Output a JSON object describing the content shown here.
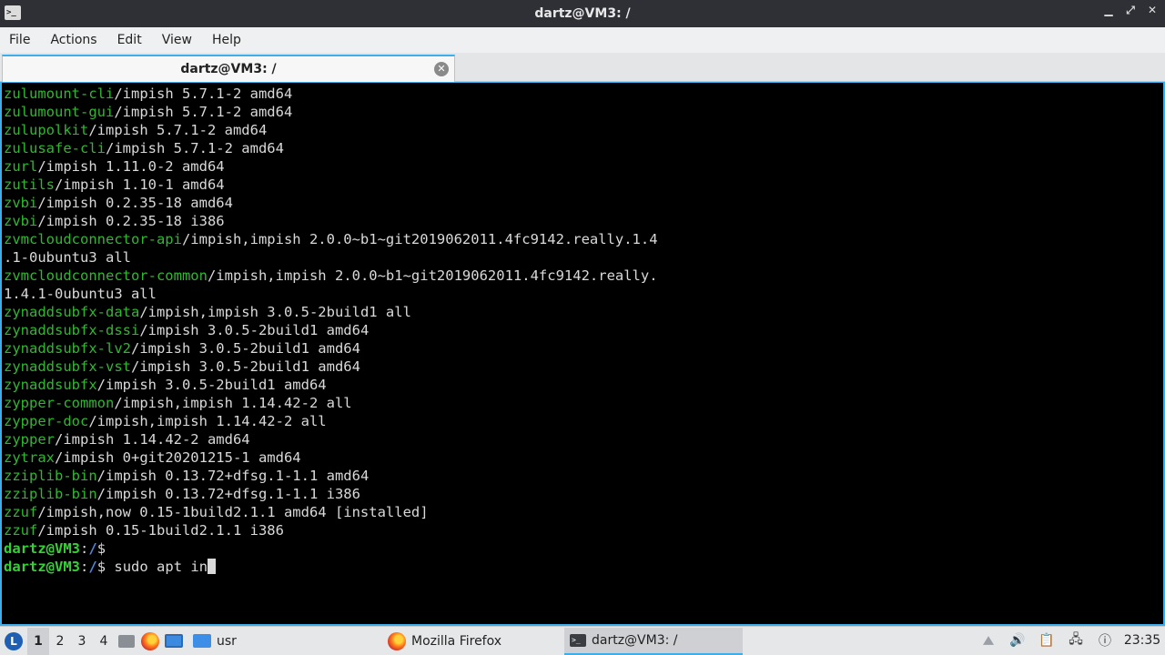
{
  "window": {
    "title": "dartz@VM3: /",
    "app_icon_glyph": ">_",
    "controls": {
      "minimize": "▁",
      "maximize": "⤢",
      "close": "✕"
    }
  },
  "menu": {
    "items": [
      "File",
      "Actions",
      "Edit",
      "View",
      "Help"
    ]
  },
  "tab": {
    "label": "dartz@VM3: /",
    "close_glyph": "✕"
  },
  "terminal": {
    "lines": [
      {
        "pkg": "zulumount-cli",
        "rest": "/impish 5.7.1-2 amd64"
      },
      {
        "pkg": "zulumount-gui",
        "rest": "/impish 5.7.1-2 amd64"
      },
      {
        "pkg": "zulupolkit",
        "rest": "/impish 5.7.1-2 amd64"
      },
      {
        "pkg": "zulusafe-cli",
        "rest": "/impish 5.7.1-2 amd64"
      },
      {
        "pkg": "zurl",
        "rest": "/impish 1.11.0-2 amd64"
      },
      {
        "pkg": "zutils",
        "rest": "/impish 1.10-1 amd64"
      },
      {
        "pkg": "zvbi",
        "rest": "/impish 0.2.35-18 amd64"
      },
      {
        "pkg": "zvbi",
        "rest": "/impish 0.2.35-18 i386"
      },
      {
        "pkg": "zvmcloudconnector-api",
        "rest": "/impish,impish 2.0.0~b1~git2019062011.4fc9142.really.1.4"
      },
      {
        "pkg": "",
        "rest": ".1-0ubuntu3 all"
      },
      {
        "pkg": "zvmcloudconnector-common",
        "rest": "/impish,impish 2.0.0~b1~git2019062011.4fc9142.really."
      },
      {
        "pkg": "",
        "rest": "1.4.1-0ubuntu3 all"
      },
      {
        "pkg": "zynaddsubfx-data",
        "rest": "/impish,impish 3.0.5-2build1 all"
      },
      {
        "pkg": "zynaddsubfx-dssi",
        "rest": "/impish 3.0.5-2build1 amd64"
      },
      {
        "pkg": "zynaddsubfx-lv2",
        "rest": "/impish 3.0.5-2build1 amd64"
      },
      {
        "pkg": "zynaddsubfx-vst",
        "rest": "/impish 3.0.5-2build1 amd64"
      },
      {
        "pkg": "zynaddsubfx",
        "rest": "/impish 3.0.5-2build1 amd64"
      },
      {
        "pkg": "zypper-common",
        "rest": "/impish,impish 1.14.42-2 all"
      },
      {
        "pkg": "zypper-doc",
        "rest": "/impish,impish 1.14.42-2 all"
      },
      {
        "pkg": "zypper",
        "rest": "/impish 1.14.42-2 amd64"
      },
      {
        "pkg": "zytrax",
        "rest": "/impish 0+git20201215-1 amd64"
      },
      {
        "pkg": "zziplib-bin",
        "rest": "/impish 0.13.72+dfsg.1-1.1 amd64"
      },
      {
        "pkg": "zziplib-bin",
        "rest": "/impish 0.13.72+dfsg.1-1.1 i386"
      },
      {
        "pkg": "zzuf",
        "rest": "/impish,now 0.15-1build2.1.1 amd64 [installed]"
      },
      {
        "pkg": "zzuf",
        "rest": "/impish 0.15-1build2.1.1 i386"
      }
    ],
    "prompt_user": "dartz@VM3",
    "prompt_sep": ":",
    "prompt_path": "/",
    "prompt_symbol": "$",
    "previous_command": "",
    "current_command": "sudo apt in"
  },
  "taskbar": {
    "start_logo": "L",
    "workspaces": [
      "1",
      "2",
      "3",
      "4"
    ],
    "active_workspace": "1",
    "quicklaunch": [
      "file-manager-icon",
      "firefox-icon",
      "show-desktop-icon"
    ],
    "tasks": [
      {
        "label": "usr",
        "icon": "folder-icon"
      },
      {
        "label": "Mozilla Firefox",
        "icon": "firefox-icon"
      },
      {
        "label": "dartz@VM3: /",
        "icon": "terminal-icon"
      }
    ],
    "tray": {
      "volume_glyph": "🔊",
      "clipboard_glyph": "📋",
      "network_glyph": "🖧",
      "update_glyph": "ⓘ",
      "clock": "23:35"
    }
  },
  "colors": {
    "accent": "#3daee9",
    "package_name": "#2fb82f",
    "prompt_user": "#34d134",
    "prompt_path": "#4b8be6",
    "terminal_bg": "#000000"
  }
}
